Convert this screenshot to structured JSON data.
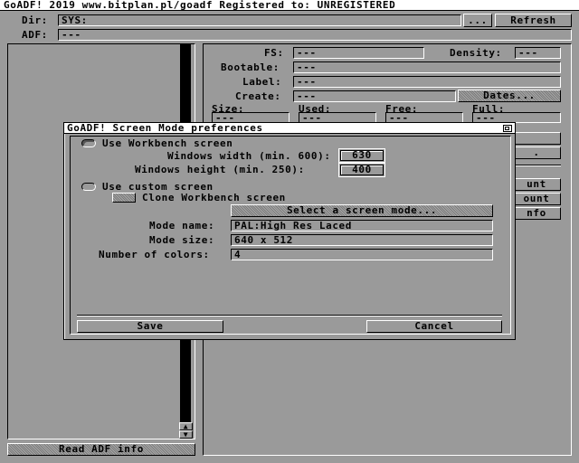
{
  "window": {
    "title": "GoADF! 2019 www.bitplan.pl/goadf  Registered to: UNREGISTERED"
  },
  "main": {
    "dir_label": "Dir:",
    "dir_value": "SYS:",
    "dots_label": "...",
    "refresh_label": "Refresh",
    "adf_label": "ADF:",
    "adf_value": "---",
    "read_adf_info_label": "Read ADF info"
  },
  "info": {
    "fs_label": "FS:",
    "fs_value": "---",
    "density_label": "Density:",
    "density_value": "---",
    "bootable_label": "Bootable:",
    "bootable_value": "---",
    "label_label": "Label:",
    "label_value": "---",
    "create_label": "Create:",
    "create_value": "---",
    "dates_label": "Dates...",
    "size_label": "Size:",
    "size_value": "---",
    "used_label": "Used:",
    "used_value": "---",
    "free_label": "Free:",
    "free_value": "---",
    "full_label": "Full:",
    "full_value": "---",
    "partial_buttons": [
      ".",
      "unt",
      "ount",
      "nfo"
    ]
  },
  "dialog": {
    "title": "GoADF! Screen Mode preferences",
    "use_workbench_label": "Use Workbench screen",
    "windows_width_label": "Windows width (min. 600):",
    "windows_width_value": "630",
    "windows_height_label": "Windows height (min. 250):",
    "windows_height_value": "400",
    "use_custom_label": "Use custom screen",
    "clone_workbench_label": "Clone Workbench screen",
    "select_mode_label": "Select a screen mode...",
    "mode_name_label": "Mode name:",
    "mode_name_value": "PAL:High Res Laced",
    "mode_size_label": "Mode size:",
    "mode_size_value": "640 x 512",
    "num_colors_label": "Number of colors:",
    "num_colors_value": "4",
    "save_label": "Save",
    "cancel_label": "Cancel"
  },
  "colors": {
    "background": "#9a9a9a",
    "shine": "#ffffff",
    "shadow": "#000000"
  }
}
